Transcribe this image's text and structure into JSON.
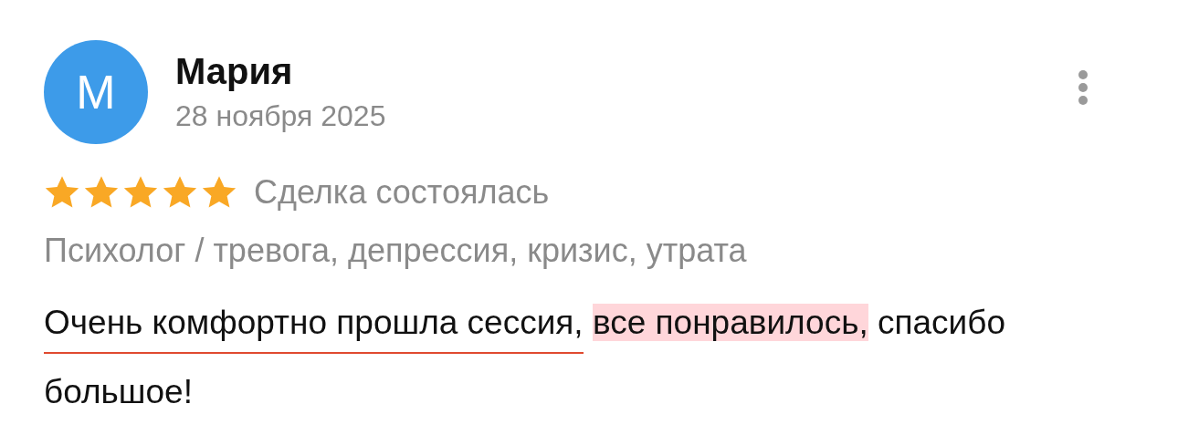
{
  "review": {
    "avatar_letter": "М",
    "author": "Мария",
    "date": "28 ноября 2025",
    "stars": 5,
    "status": "Сделка состоялась",
    "category": "Психолог / тревога, депрессия, кризис, утрата",
    "text": [
      {
        "text": "Очень комфортно прошла сессия,",
        "kind": "underline"
      },
      {
        "text": "все понравилось,",
        "kind": "highlight"
      },
      {
        "text": "спасибо большое!",
        "kind": "plain"
      }
    ]
  }
}
